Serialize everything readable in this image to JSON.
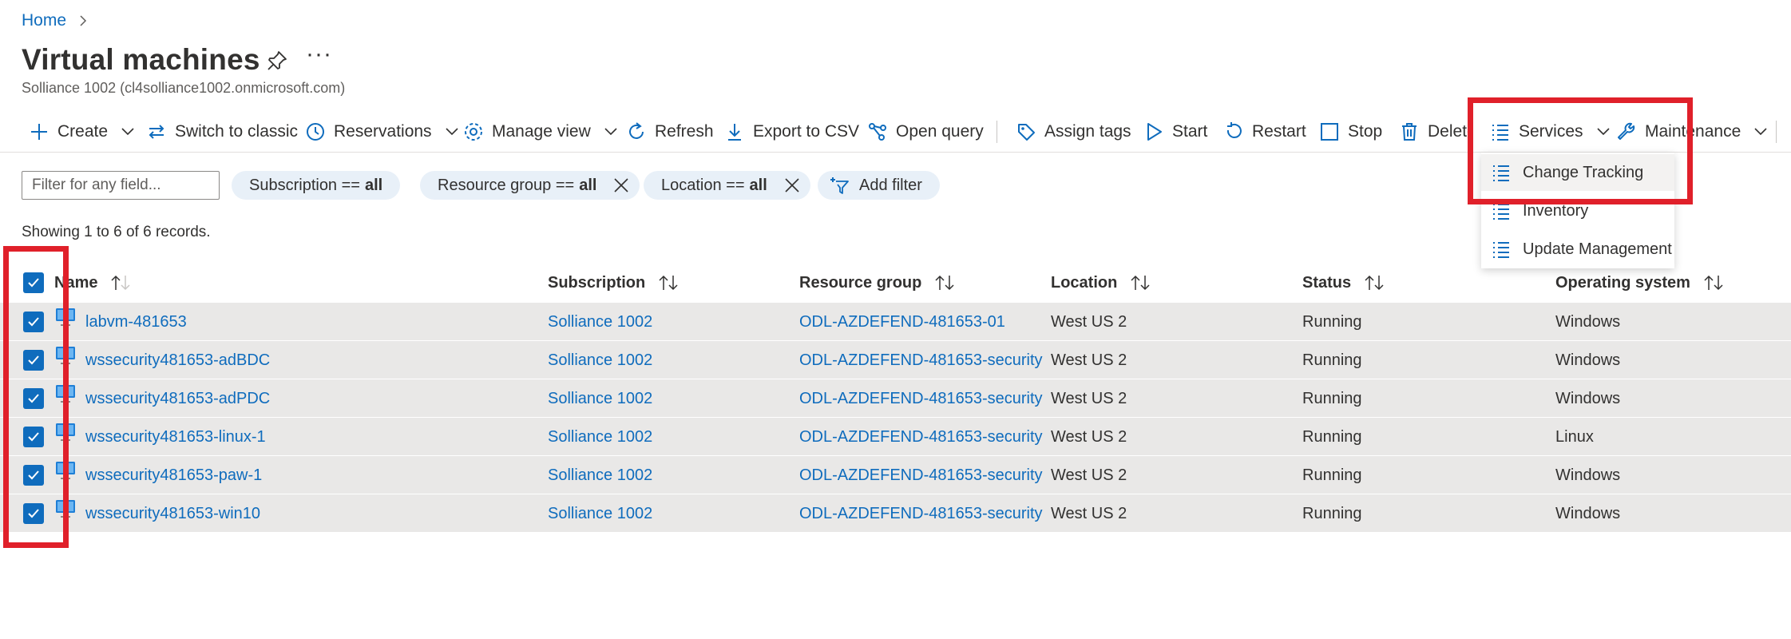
{
  "breadcrumb": {
    "home": "Home"
  },
  "page": {
    "title": "Virtual machines",
    "subtitle": "Solliance 1002 (cl4solliance1002.onmicrosoft.com)",
    "more": "···"
  },
  "toolbar": {
    "create": "Create",
    "switch_classic": "Switch to classic",
    "reservations": "Reservations",
    "manage_view": "Manage view",
    "refresh": "Refresh",
    "export_csv": "Export to CSV",
    "open_query": "Open query",
    "assign_tags": "Assign tags",
    "start": "Start",
    "restart": "Restart",
    "stop": "Stop",
    "delete": "Delete",
    "services": "Services",
    "maintenance": "Maintenance"
  },
  "services_menu": {
    "items": [
      "Change Tracking",
      "Inventory",
      "Update Management"
    ],
    "hovered": "Change Tracking"
  },
  "filters": {
    "placeholder": "Filter for any field...",
    "subscription": {
      "label": "Subscription ==",
      "value": "all"
    },
    "resource_group": {
      "label": "Resource group ==",
      "value": "all"
    },
    "location": {
      "label": "Location ==",
      "value": "all"
    },
    "add_filter": "Add filter"
  },
  "records_text": "Showing 1 to 6 of 6 records.",
  "table": {
    "columns": [
      "Name",
      "Subscription",
      "Resource group",
      "Location",
      "Status",
      "Operating system"
    ],
    "rows": [
      [
        "labvm-481653",
        "Solliance 1002",
        "ODL-AZDEFEND-481653-01",
        "West US 2",
        "Running",
        "Windows"
      ],
      [
        "wssecurity481653-adBDC",
        "Solliance 1002",
        "ODL-AZDEFEND-481653-security",
        "West US 2",
        "Running",
        "Windows"
      ],
      [
        "wssecurity481653-adPDC",
        "Solliance 1002",
        "ODL-AZDEFEND-481653-security",
        "West US 2",
        "Running",
        "Windows"
      ],
      [
        "wssecurity481653-linux-1",
        "Solliance 1002",
        "ODL-AZDEFEND-481653-security",
        "West US 2",
        "Running",
        "Linux"
      ],
      [
        "wssecurity481653-paw-1",
        "Solliance 1002",
        "ODL-AZDEFEND-481653-security",
        "West US 2",
        "Running",
        "Windows"
      ],
      [
        "wssecurity481653-win10",
        "Solliance 1002",
        "ODL-AZDEFEND-481653-security",
        "West US 2",
        "Running",
        "Windows"
      ]
    ],
    "all_selected": true
  },
  "colors": {
    "accent": "#0f6cbd",
    "annotation": "#e0202a",
    "row_bg": "#e9e8e7"
  }
}
